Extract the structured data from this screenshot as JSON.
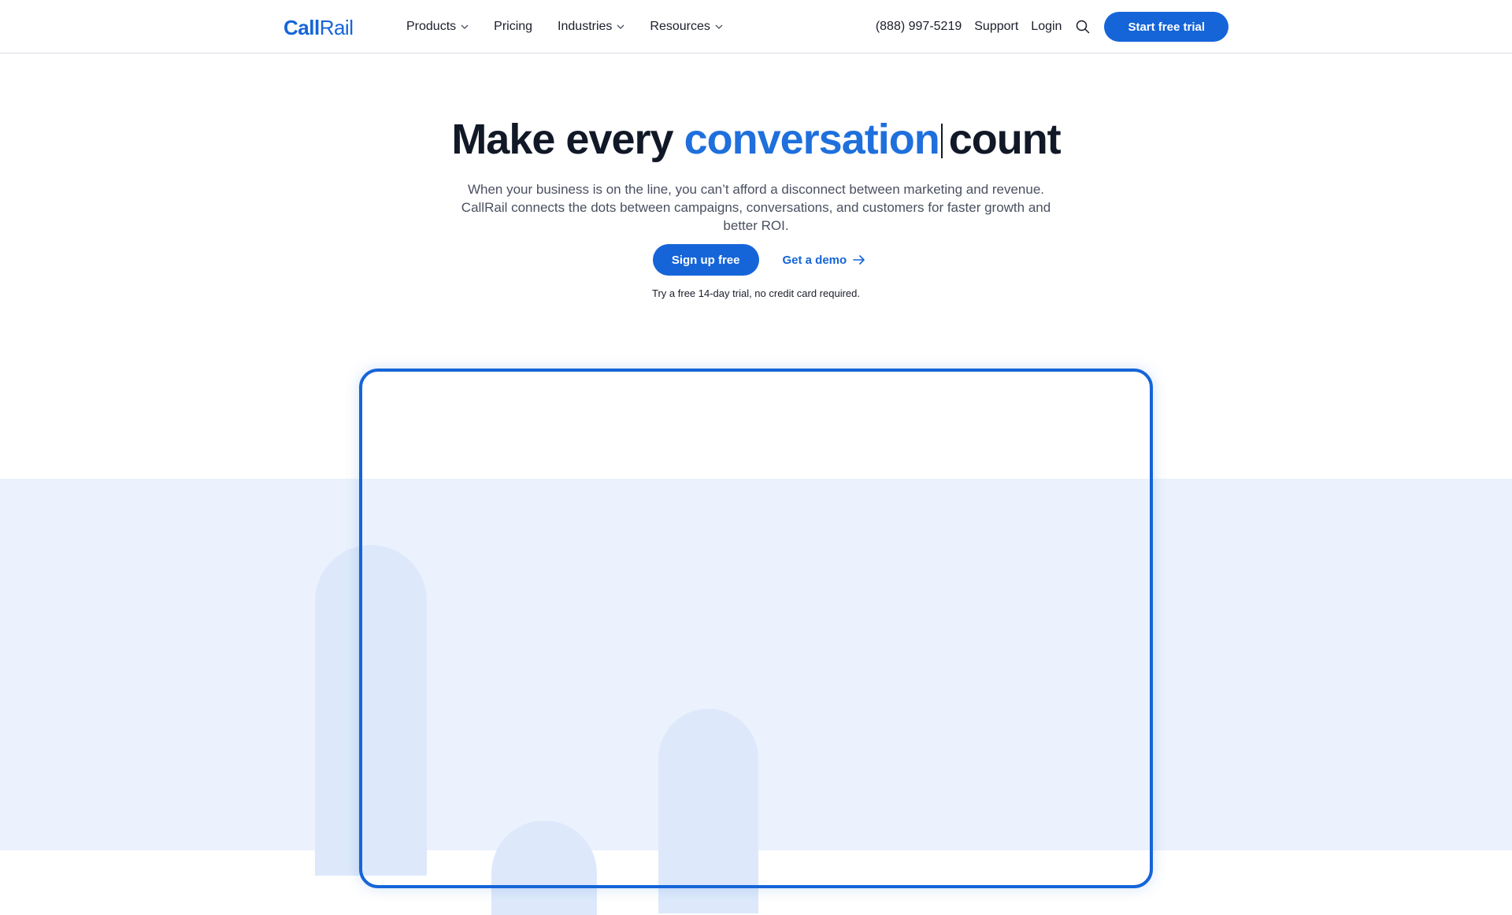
{
  "brand": {
    "logo_part1": "Call",
    "logo_part2": "Rail",
    "accent_color": "#1565d8"
  },
  "nav": {
    "items": [
      {
        "label": "Products",
        "has_dropdown": true
      },
      {
        "label": "Pricing",
        "has_dropdown": false
      },
      {
        "label": "Industries",
        "has_dropdown": true
      },
      {
        "label": "Resources",
        "has_dropdown": true
      }
    ],
    "phone": "(888) 997-5219",
    "support": "Support",
    "login": "Login",
    "search_icon": "search-icon",
    "cta": "Start free trial"
  },
  "hero": {
    "headline_prefix": "Make every",
    "headline_accent": "conversation",
    "headline_suffix": "count",
    "subcopy": "When your business is on the line, you can’t afford a disconnect between marketing and revenue. CallRail connects the dots between campaigns, conversations, and customers for faster growth and better ROI.",
    "primary_cta": "Sign up free",
    "secondary_cta": "Get a demo",
    "trial_note": "Try a free 14-day trial, no credit card required."
  },
  "colors": {
    "band": "#ebf2fd",
    "pill": "#dde9fb",
    "headline": "#111827"
  }
}
